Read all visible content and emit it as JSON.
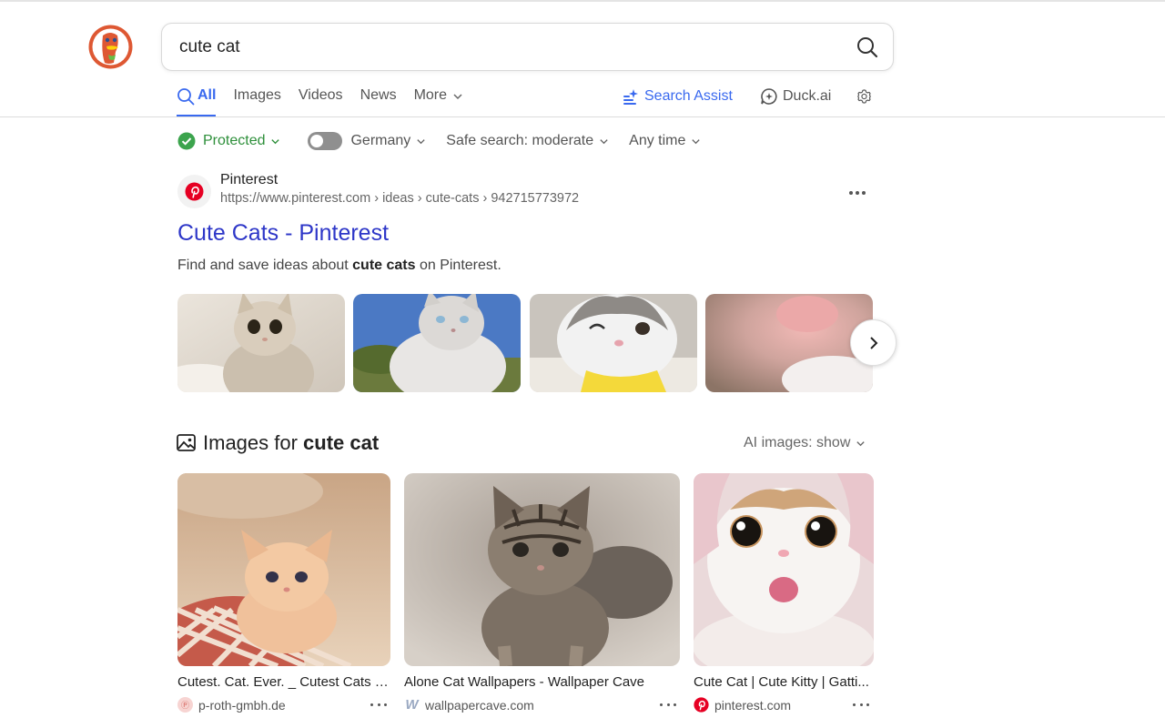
{
  "search": {
    "query": "cute cat",
    "placeholder": ""
  },
  "tabs": [
    {
      "label": "All",
      "active": true
    },
    {
      "label": "Images"
    },
    {
      "label": "Videos"
    },
    {
      "label": "News"
    },
    {
      "label": "More"
    }
  ],
  "nav_right": {
    "search_assist": "Search Assist",
    "duck_ai": "Duck.ai"
  },
  "filters": {
    "protected": "Protected",
    "region": "Germany",
    "safe_search": "Safe search: moderate",
    "time": "Any time"
  },
  "result": {
    "source_name": "Pinterest",
    "url": "https://www.pinterest.com › ideas › cute-cats › 942715773972",
    "title": "Cute Cats - Pinterest",
    "snippet_pre": "Find and save ideas about ",
    "snippet_bold": "cute cats",
    "snippet_post": " on Pinterest."
  },
  "images_section": {
    "title_pre": "Images for ",
    "title_bold": "cute cat",
    "ai_images": "AI images: show"
  },
  "image_cards": [
    {
      "caption": "Cutest. Cat. Ever. _ Cutest Cats - ...",
      "source": "p-roth-gmbh.de"
    },
    {
      "caption": "Alone Cat Wallpapers - Wallpaper Cave",
      "source": "wallpapercave.com"
    },
    {
      "caption": "Cute Cat | Cute Kitty | Gatti...",
      "source": "pinterest.com"
    }
  ],
  "colors": {
    "accent": "#3969ef",
    "link": "#2e37c8",
    "protected": "#2d8f3a",
    "pinterest": "#e60023"
  }
}
